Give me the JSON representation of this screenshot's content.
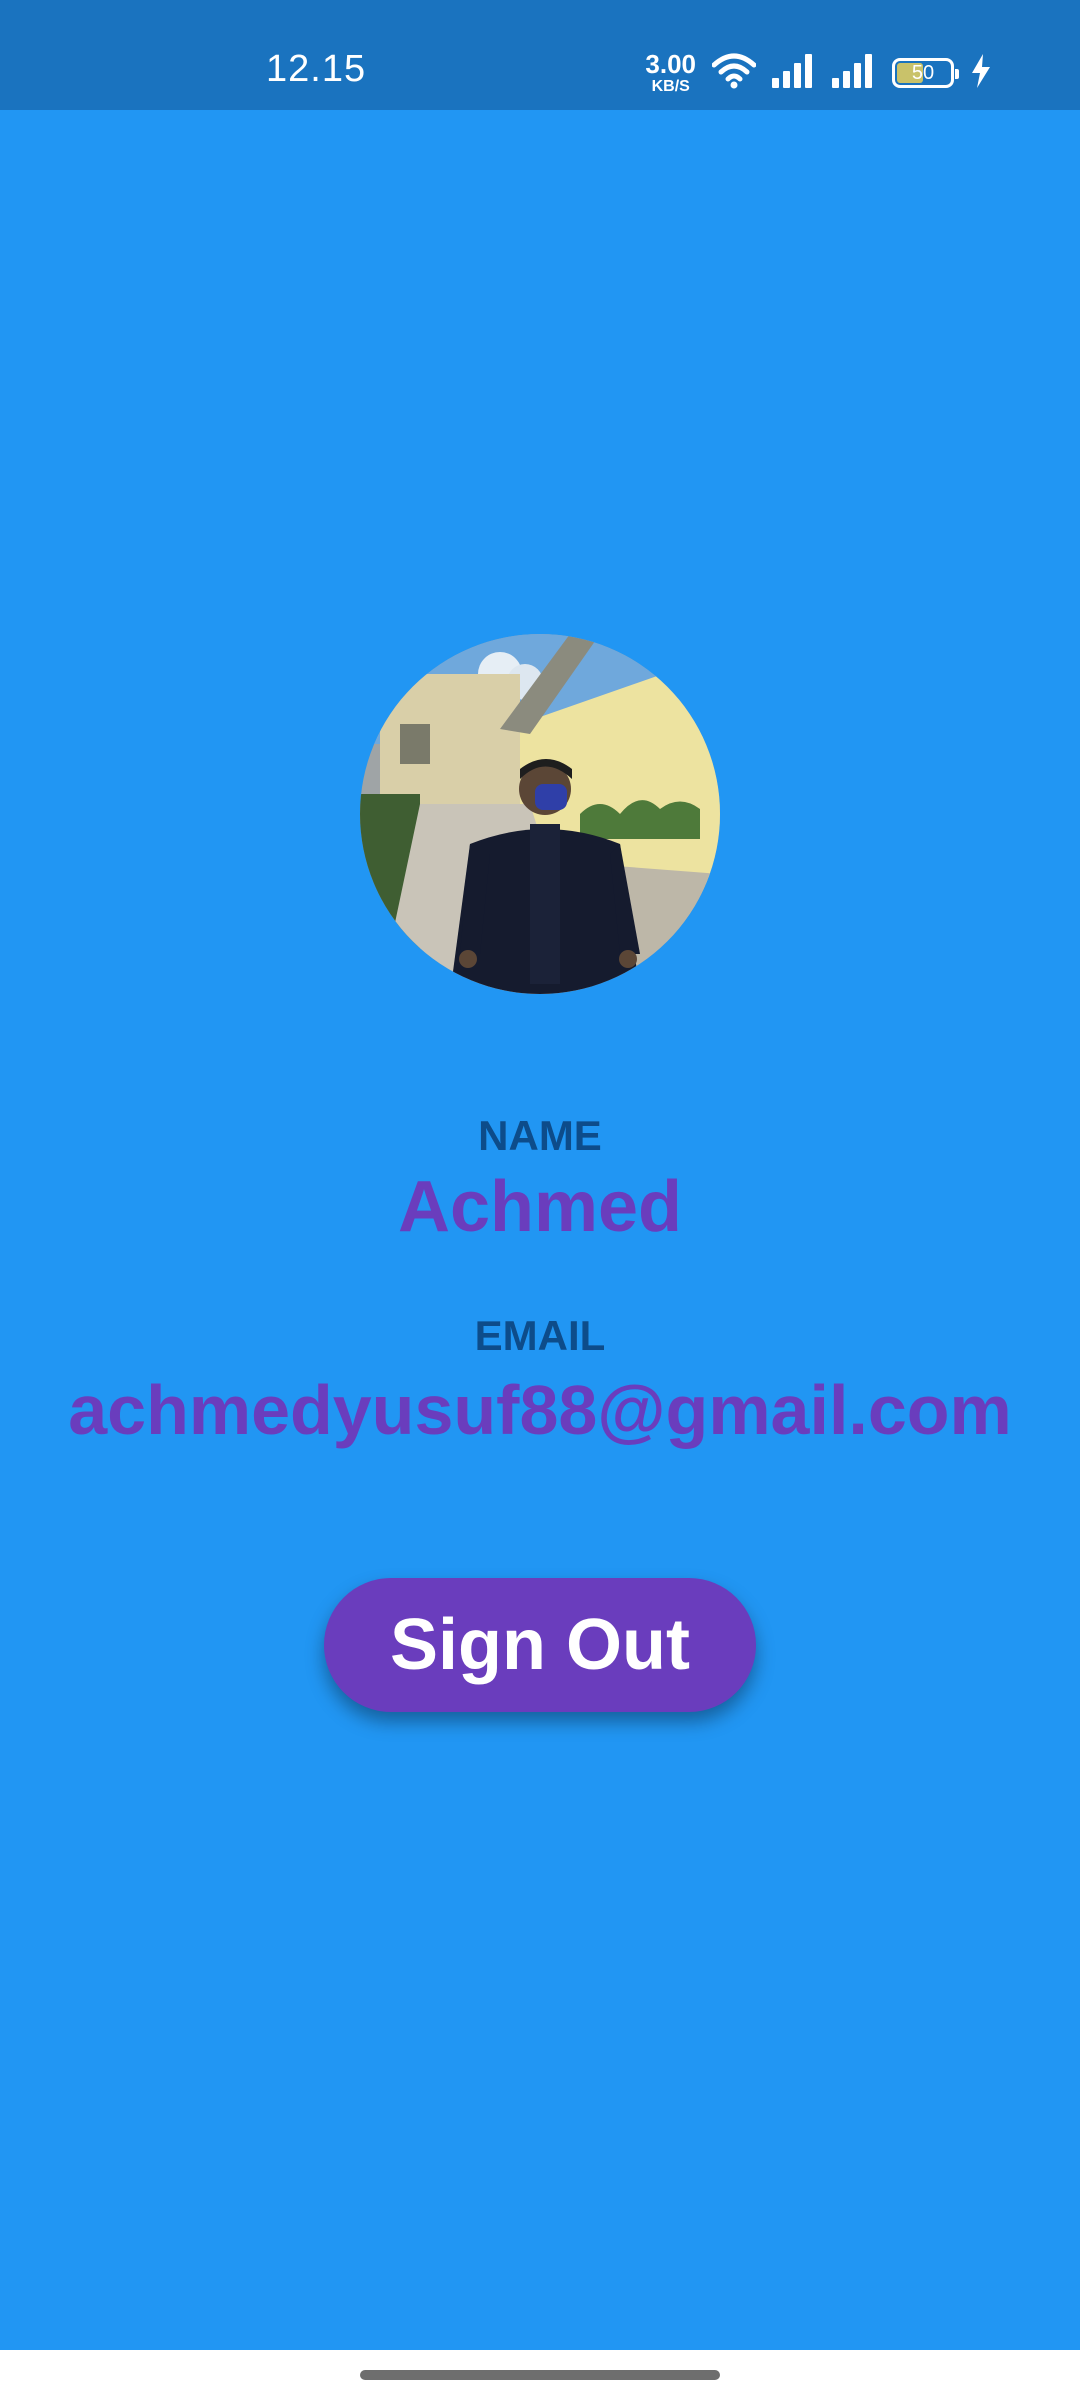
{
  "status_bar": {
    "time": "12.15",
    "net_speed_value": "3.00",
    "net_speed_unit": "KB/S",
    "battery_level": "50",
    "icons": [
      "wifi-icon",
      "signal-icon",
      "signal-icon",
      "battery-icon",
      "charging-icon"
    ]
  },
  "profile": {
    "avatar_alt": "profile photo",
    "name_label": "NAME",
    "name_value": "Achmed",
    "email_label": "EMAIL",
    "email_value": "achmedyusuf88@gmail.com"
  },
  "actions": {
    "sign_out_label": "Sign Out"
  },
  "colors": {
    "background": "#2196F3",
    "status_bar": "#1A73BF",
    "label": "#0D4C8A",
    "value": "#6A3DBD",
    "button": "#6A3DBD"
  }
}
